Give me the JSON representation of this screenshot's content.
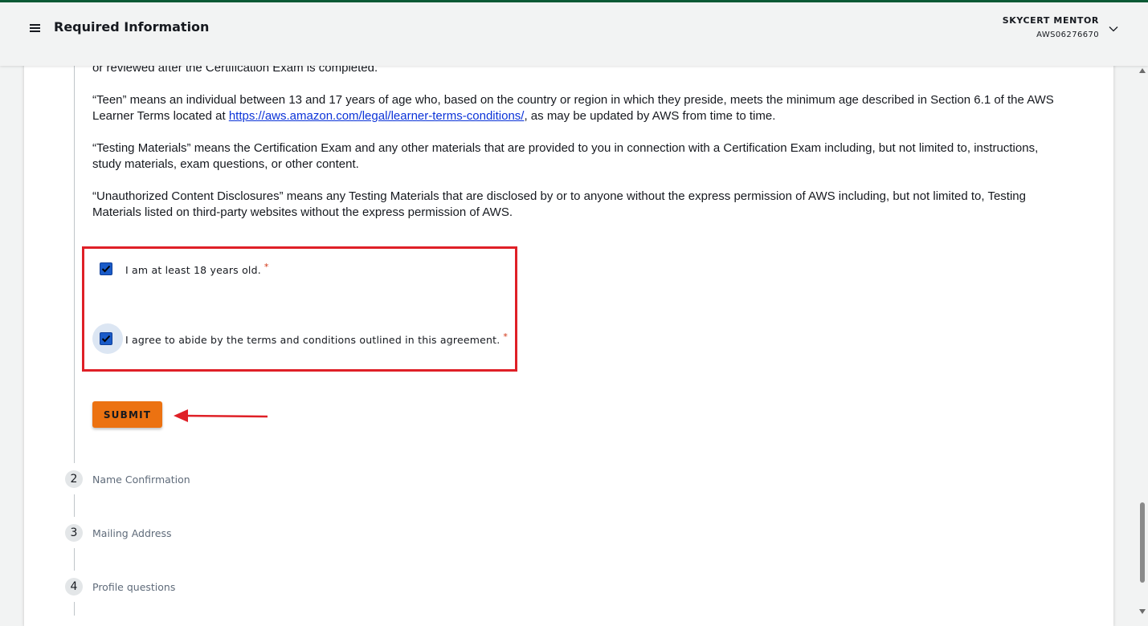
{
  "header": {
    "title": "Required Information",
    "user_name": "SKYCERT MENTOR",
    "user_id": "AWS06276670",
    "menu_icon": "hamburger-menu-icon",
    "chevron_icon": "chevron-down-icon"
  },
  "terms": {
    "partial_line": "or reviewed after the Certification Exam is completed.",
    "teen_part1": "“Teen” means an individual between 13 and 17 years of age who, based on the country or region in which they preside, meets the minimum age described in Section 6.1 of the AWS Learner Terms located at ",
    "teen_link": "https://aws.amazon.com/legal/learner-terms-conditions/",
    "teen_part2": ", as may be updated by AWS from time to time.",
    "testing_materials": "“Testing Materials” means the Certification Exam and any other materials that are provided to you in connection with a Certification Exam including, but not limited to, instructions, study materials, exam questions, or other content.",
    "unauthorized": "“Unauthorized Content Disclosures” means any Testing Materials that are disclosed by or to anyone without the express permission of AWS including, but not limited to, Testing Materials listed on third-party websites without the express permission of AWS."
  },
  "agreements": {
    "age_label": "I am at least 18 years old.",
    "age_checked": true,
    "terms_label": "I agree to abide by the terms and conditions outlined in this agreement.",
    "terms_checked": true,
    "required_marker": "*"
  },
  "submit_label": "SUBMIT",
  "steps": [
    {
      "number": "2",
      "label": "Name Confirmation"
    },
    {
      "number": "3",
      "label": "Mailing Address"
    },
    {
      "number": "4",
      "label": "Profile questions"
    }
  ],
  "colors": {
    "accent_orange": "#ec7211",
    "checkbox_blue": "#1a5bc8",
    "annotation_red": "#df2027",
    "link_blue": "#0b33d8",
    "top_stripe": "#0b5a36"
  }
}
